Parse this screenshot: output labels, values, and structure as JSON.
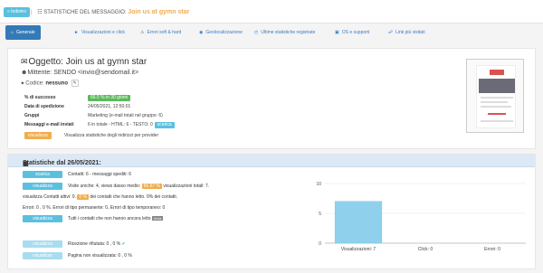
{
  "topbar": {
    "back_label": "« Indietro",
    "breadcrumb_label": "STATISTICHE DEL MESSAGGIO:",
    "subject": "Join us at gymn star"
  },
  "tabs": [
    {
      "label": "Generale",
      "icon": "home-icon"
    },
    {
      "label": "Visualizzazioni e click",
      "icon": "cursor-icon"
    },
    {
      "label": "Errori soft & hard",
      "icon": "error-icon"
    },
    {
      "label": "Geolocalizzazione",
      "icon": "globe-icon"
    },
    {
      "label": "Ultime statistiche registrate",
      "icon": "clock-icon"
    },
    {
      "label": "OS e supporti",
      "icon": "desktop-icon"
    },
    {
      "label": "Link più visitati",
      "icon": "link-icon"
    }
  ],
  "overview": {
    "object_label": "Oggetto:",
    "object_value": "Join us at gymn star",
    "sender_label": "Mittente:",
    "sender_value": "SENDO <invio@sendomail.it>",
    "code_label": "Codice:",
    "code_value": "nessuno",
    "success_label": "% di successo",
    "success_value": "66.5 % in 30 giorni",
    "date_label": "Data di spedizione",
    "date_value": "24/05/2021, 12:50:01",
    "groups_label": "Gruppi",
    "groups_value": "Marketing (e-mail totali nel gruppo: 6)",
    "sent_label": "Messaggi e-mail inviati",
    "sent_value": "6 in totale - HTML: 6 - TESTO: 0",
    "download_label": "scarica",
    "provider_button": "visualizza",
    "provider_text": "Visualizza statistiche degli indirizzi per provider"
  },
  "stats": {
    "header": "Statistiche dal 26/05/2021:",
    "row1_button": "scarica",
    "row1_text": "Contatti: 6 - messaggi spediti: 6",
    "row2_button": "visualizza",
    "row2_text_a": "Visite uniche: 4, views dasso medio:",
    "row2_highlight": "66.67 %",
    "row2_text_b": "visualizzazioni totali: 7.",
    "row3_text_a": "visualizza Contatti attivi: 0.",
    "row3_highlight": "0 %",
    "row3_text_b": "dei contatti che hanno letto.",
    "row3_text_c": "0% dei contatti.",
    "row4_text": "Errori: 0 , 0 %. Errori di tipo permanente: 0, Errori di tipo temporaneo: 0",
    "row5_button": "visualizza",
    "row5_text": "Tutti i contatti che non hanno ancora letto",
    "row5_badge": "Invia",
    "row6_button": "visualizza",
    "row6_text": "Ricezione rifiutata: 0 , 0 %",
    "row7_button": "visualizza",
    "row7_text": "Pagina non visualizzata: 0 , 0 %"
  },
  "chart_data": {
    "type": "bar",
    "categories": [
      "Visualizzazioni: 7",
      "Click: 0",
      "Errori: 0"
    ],
    "values": [
      7,
      0,
      0
    ],
    "ylim": [
      0,
      10
    ],
    "yticks": [
      0,
      5,
      10
    ],
    "colors": {
      "bar": "#8fd1ec",
      "bar_stroke": "#6fc2e3",
      "grid": "#e5e5e5"
    },
    "grid": true
  }
}
